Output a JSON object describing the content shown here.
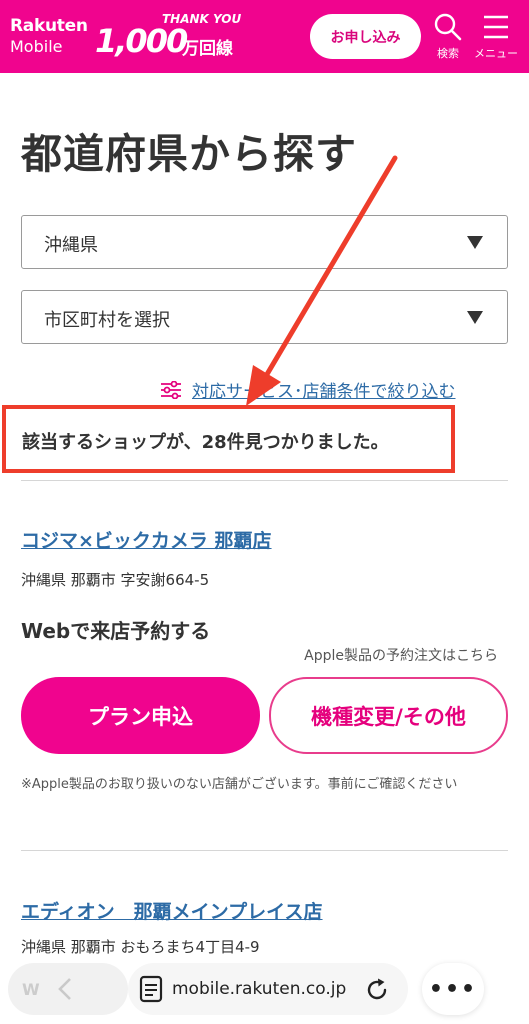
{
  "header": {
    "logo_line1": "Rakuten",
    "logo_line2": "Mobile",
    "thanks_top": "THANK YOU",
    "thanks_number": "1,000",
    "thanks_suffix": "万回線",
    "apply_label": "お申し込み",
    "search_label": "検索",
    "menu_label": "メニュー",
    "brand_color": "#f0048e"
  },
  "main": {
    "title": "都道府県から探す",
    "prefecture_select": "沖縄県",
    "city_select": "市区町村を選択",
    "filter_link": "対応サービス･店舗条件で絞り込む",
    "result_text": "該当するショップが、28件見つかりました。"
  },
  "shops": [
    {
      "name": "コジマ×ビックカメラ 那覇店",
      "address": "沖縄県 那覇市 字安謝664-5",
      "web_reservation": "Webで来店予約する",
      "apple_note": "Apple製品の予約注文はこちら",
      "plan_button": "プラン申込",
      "change_button": "機種変更/その他",
      "disclaimer": "※Apple製品のお取り扱いのない店舗がございます。事前にご確認ください"
    },
    {
      "name": "エディオン　那覇メインプレイス店",
      "address": "沖縄県 那覇市 おもろまち4丁目4-9"
    }
  ],
  "browser": {
    "url": "mobile.rakuten.co.jp",
    "more_label": "•••",
    "back_label": "W"
  }
}
